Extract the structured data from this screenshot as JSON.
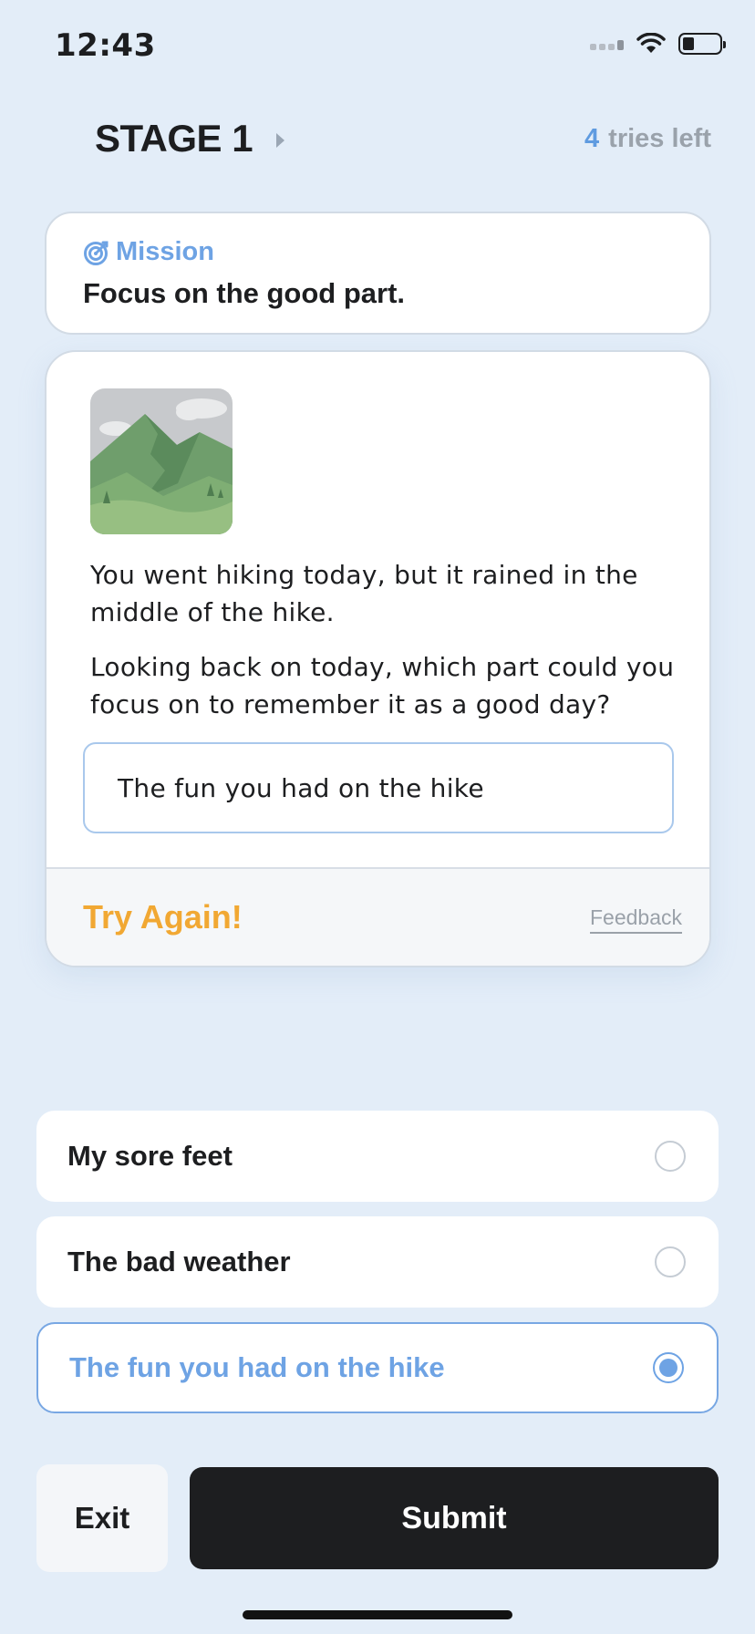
{
  "status_bar": {
    "time": "12:43"
  },
  "header": {
    "stage": "STAGE 1",
    "tries_count": "4",
    "tries_label": "tries left"
  },
  "mission": {
    "label": "Mission",
    "text": "Focus on the good part."
  },
  "question": {
    "illustration": "mountain-landscape",
    "paragraph1": "You went hiking today, but it rained in the middle of the hike.",
    "paragraph2": "Looking back on today, which part could you focus on to remember it as a good day?",
    "answer": "The fun you had on the hike",
    "result": "Try Again!",
    "feedback_link": "Feedback"
  },
  "options": [
    {
      "label": "My sore feet",
      "selected": false
    },
    {
      "label": "The bad weather",
      "selected": false
    },
    {
      "label": "The fun you had on the hike",
      "selected": true
    }
  ],
  "buttons": {
    "exit": "Exit",
    "submit": "Submit"
  },
  "colors": {
    "accent": "#6ea3e4",
    "warning": "#f1a833",
    "background": "#e3edf8",
    "dark": "#1d1e20"
  }
}
